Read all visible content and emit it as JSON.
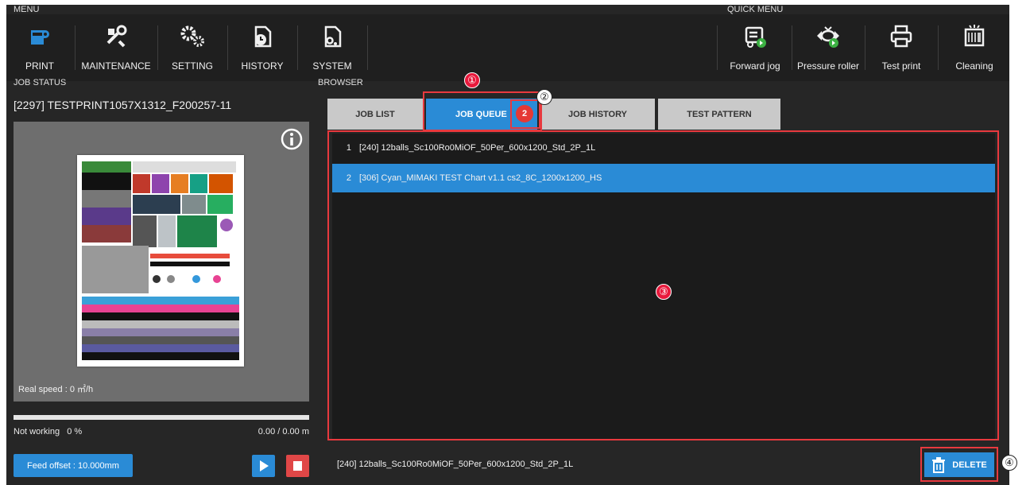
{
  "menu": {
    "section_label": "MENU",
    "items": [
      {
        "label": "PRINT",
        "icon": "print-icon"
      },
      {
        "label": "MAINTENANCE",
        "icon": "maintenance-icon"
      },
      {
        "label": "SETTING",
        "icon": "setting-icon"
      },
      {
        "label": "HISTORY",
        "icon": "history-icon"
      },
      {
        "label": "SYSTEM",
        "icon": "system-icon"
      }
    ]
  },
  "quick_menu": {
    "section_label": "QUICK MENU",
    "items": [
      {
        "label": "Forward jog",
        "icon": "forward-jog-icon"
      },
      {
        "label": "Pressure roller",
        "icon": "pressure-roller-icon"
      },
      {
        "label": "Test print",
        "icon": "test-print-icon"
      },
      {
        "label": "Cleaning",
        "icon": "cleaning-icon"
      }
    ]
  },
  "job_status": {
    "section_label": "JOB STATUS",
    "job_title": "[2297] TESTPRINT1057X1312_F200257-11",
    "real_speed": "Real speed : 0 ㎡/h",
    "state": "Not working",
    "percent": "0 %",
    "progress_fraction": 0,
    "length": "0.00 / 0.00 m",
    "feed_offset": "Feed offset : 10.000mm"
  },
  "browser": {
    "section_label": "BROWSER",
    "tabs": [
      {
        "label": "JOB LIST"
      },
      {
        "label": "JOB QUEUE",
        "badge": "2"
      },
      {
        "label": "JOB HISTORY"
      },
      {
        "label": "TEST PATTERN"
      }
    ],
    "queue": [
      {
        "num": "1",
        "name": "[240] 12balls_Sc100Ro0MiOF_50Per_600x1200_Std_2P_1L"
      },
      {
        "num": "2",
        "name": "[306] Cyan_MIMAKI TEST Chart v1.1 cs2_8C_1200x1200_HS"
      }
    ],
    "selected_job": "[240] 12balls_Sc100Ro0MiOF_50Per_600x1200_Std_2P_1L",
    "delete_label": "DELETE"
  },
  "callouts": [
    "①",
    "②",
    "③",
    "④"
  ],
  "colors": {
    "accent": "#2a8bd6",
    "danger": "#e04747",
    "callout": "#e8193c"
  }
}
